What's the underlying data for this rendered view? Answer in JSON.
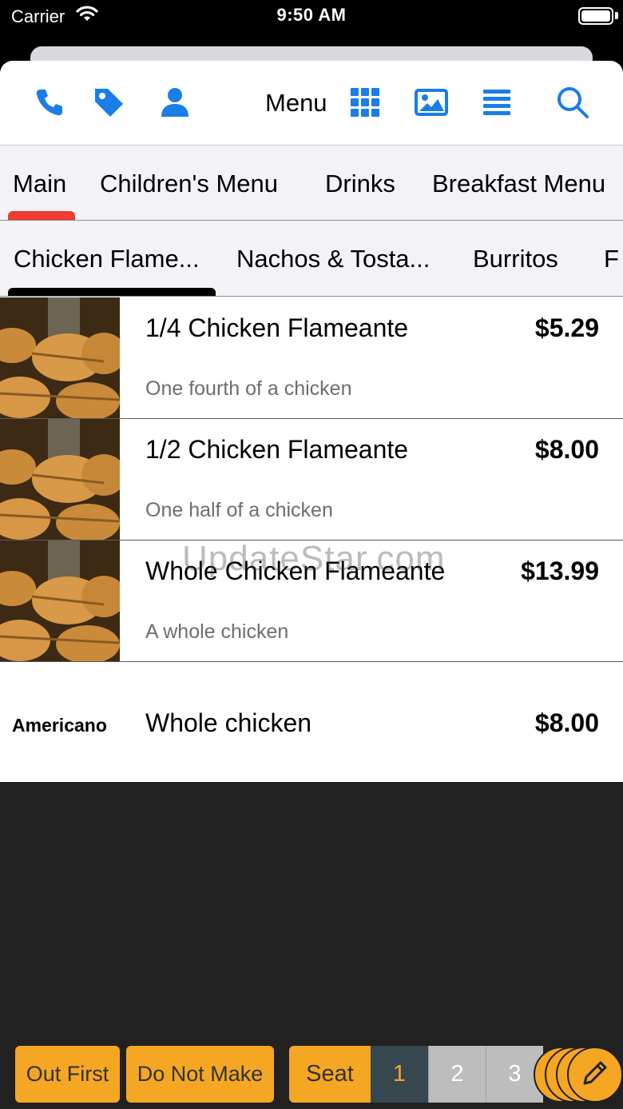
{
  "status_bar": {
    "carrier": "Carrier",
    "time": "9:50 AM"
  },
  "toolbar": {
    "title": "Menu",
    "accent_color": "#1a7de8",
    "icons": [
      "phone-icon",
      "tag-icon",
      "person-icon",
      "grid-icon",
      "image-icon",
      "list-icon",
      "search-icon"
    ]
  },
  "category_tabs": [
    {
      "label": "Main",
      "selected": true
    },
    {
      "label": "Children's Menu",
      "selected": false
    },
    {
      "label": "Drinks",
      "selected": false
    },
    {
      "label": "Breakfast Menu",
      "selected": false
    }
  ],
  "sub_tabs": [
    {
      "label": "Chicken Flame...",
      "selected": true
    },
    {
      "label": "Nachos & Tosta...",
      "selected": false
    },
    {
      "label": "Burritos",
      "selected": false
    },
    {
      "label": "F",
      "selected": false
    }
  ],
  "items": [
    {
      "name": "1/4 Chicken Flameante",
      "price": "$5.29",
      "description": "One fourth of a chicken"
    },
    {
      "name": "1/2 Chicken Flameante",
      "price": "$8.00",
      "description": "One half of a chicken"
    },
    {
      "name": "Whole Chicken Flameante",
      "price": "$13.99",
      "description": "A whole chicken"
    },
    {
      "name": "Whole chicken",
      "price": "$8.00",
      "description": "",
      "thumb_text": "Americano"
    }
  ],
  "watermark": "UpdateStar.com",
  "bottom_bar": {
    "out_first": "Out First",
    "do_not_make": "Do Not Make",
    "seat_label": "Seat",
    "seats": [
      "1",
      "2",
      "3"
    ],
    "active_seat": "1",
    "accent_color": "#f5a623"
  }
}
